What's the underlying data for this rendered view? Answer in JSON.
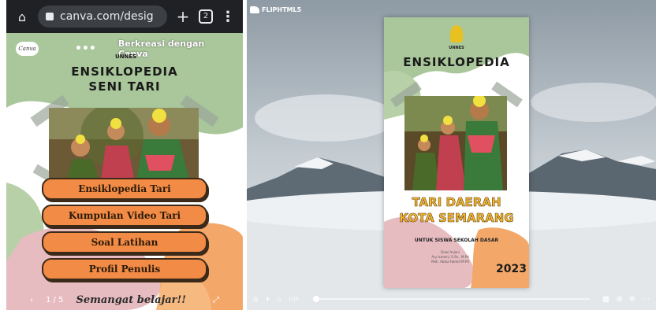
{
  "browser": {
    "url": "canva.com/desig",
    "tab_count": "2",
    "icons": [
      "home-icon",
      "lock-icon",
      "plus-icon",
      "tabs-icon",
      "menu-icon"
    ]
  },
  "canva_page": {
    "badge": "Canva",
    "header_text": "Berkreasi dengan Canva",
    "institution": "UNNES",
    "title_line1": "ENSIKLOPEDIA",
    "title_line2": "SENI TARI",
    "menu_buttons": [
      "Ensiklopedia Tari",
      "Kumpulan Video Tari",
      "Soal Latihan",
      "Profil Penulis"
    ],
    "page_number": "1 / 5",
    "footer_caption": "Semangat belajar!!",
    "colors": {
      "accent": "#f28b45",
      "green": "#a9c79a",
      "pink": "#e7bcc0"
    }
  },
  "viewer": {
    "brand": "FLIPHTML5",
    "book": {
      "institution": "UNNES",
      "title": "ENSIKLOPEDIA",
      "subtitle_line1": "TARI DAERAH",
      "subtitle_line2": "KOTA SEMARANG",
      "audience": "UNTUK SISWA SEKOLAH DASAR",
      "authors": [
        "Dewi Anjani",
        "Ary Ismaini, S.Sn., M.Pd",
        "Moh. Abdul Hamid M.Pd"
      ],
      "year": "2023"
    },
    "toolbar": {
      "page_indicator": "1/10",
      "icons": [
        "home-icon",
        "zoom-in-icon",
        "search-icon",
        "thumbnails-icon",
        "share-icon",
        "settings-icon",
        "more-icon"
      ]
    }
  }
}
